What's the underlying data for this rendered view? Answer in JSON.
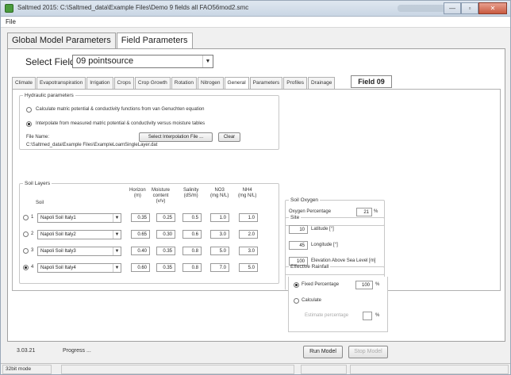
{
  "window": {
    "title": "Saltmed 2015: C:\\Saltmed_data\\Example Files\\Demo 9 fields all FAO56mod2.smc",
    "buttons": [
      "—",
      "▫",
      "✕"
    ]
  },
  "menu": {
    "file": "File"
  },
  "main_tabs": [
    "Global Model Parameters",
    "Field Parameters"
  ],
  "select_field": {
    "label": "Select Field",
    "value": "09 pointsource"
  },
  "sub_tabs": [
    "Climate",
    "Evapotranspiration",
    "Irrigation",
    "Crops",
    "Crop Growth",
    "Rotation",
    "Nitrogen",
    "General",
    "Parameters",
    "Profiles",
    "Drainage"
  ],
  "field_badge": "Field 09",
  "hydraulic": {
    "legend": "Hydraulic parameters",
    "option1": "Calculate matric potential & conductivity functions from van Genuchten equation",
    "option2": "Interpolate from measured matric potential & conductivity versus moisture tables",
    "file_name_label": "File Name:",
    "file_path": "C:\\Saltmed_data\\Example Files\\ExampleLoamSingleLayer.dat",
    "select_button": "Select Interpolation File ...",
    "clear_button": "Clear"
  },
  "soil_layers": {
    "legend": "Soil Layers",
    "headers": {
      "soil": "Soil",
      "horizon": "Horizon\n(m)",
      "moisture": "Moisture\ncontent\n(v/v)",
      "salinity": "Salinity\n(dS/m)",
      "no3": "NO3\n(mg N/L)",
      "nh4": "NH4\n(mg N/L)"
    },
    "rows": [
      {
        "num": "1",
        "soil": "Napoli Soil Italy1",
        "horizon": "0.35",
        "moisture": "0.25",
        "salinity": "0.5",
        "no3": "1.0",
        "nh4": "1.0"
      },
      {
        "num": "2",
        "soil": "Napoli Soil Italy2",
        "horizon": "0.65",
        "moisture": "0.30",
        "salinity": "0.6",
        "no3": "3.0",
        "nh4": "2.0"
      },
      {
        "num": "3",
        "soil": "Napoli Soil Italy3",
        "horizon": "0.40",
        "moisture": "0.35",
        "salinity": "0.8",
        "no3": "5.0",
        "nh4": "3.0"
      },
      {
        "num": "4",
        "soil": "Napoli Soil Italy4",
        "horizon": "0.60",
        "moisture": "0.35",
        "salinity": "0.8",
        "no3": "7.0",
        "nh4": "5.0"
      }
    ]
  },
  "soil_oxygen": {
    "legend": "Soil Oxygen",
    "label": "Oxygen Percentage",
    "value": "21",
    "unit": "%"
  },
  "site": {
    "legend": "Site",
    "latitude": {
      "value": "10",
      "label": "Latitude [°]"
    },
    "longitude": {
      "value": "45",
      "label": "Longitude [°]"
    },
    "elevation": {
      "value": "100",
      "label": "Elevation Above Sea Level [m]"
    }
  },
  "rainfall": {
    "legend": "Effective Rainfall",
    "fixed_label": "Fixed Percentage",
    "fixed_value": "100",
    "calculate_label": "Calculate",
    "estimate_label": "Estimate percentage",
    "estimate_value": "",
    "unit": "%"
  },
  "bottom": {
    "version": "3.03.21",
    "progress": "Progress ...",
    "run_button": "Run Model",
    "stop_button": "Stop Model"
  },
  "status": {
    "mode": "32bit mode"
  }
}
